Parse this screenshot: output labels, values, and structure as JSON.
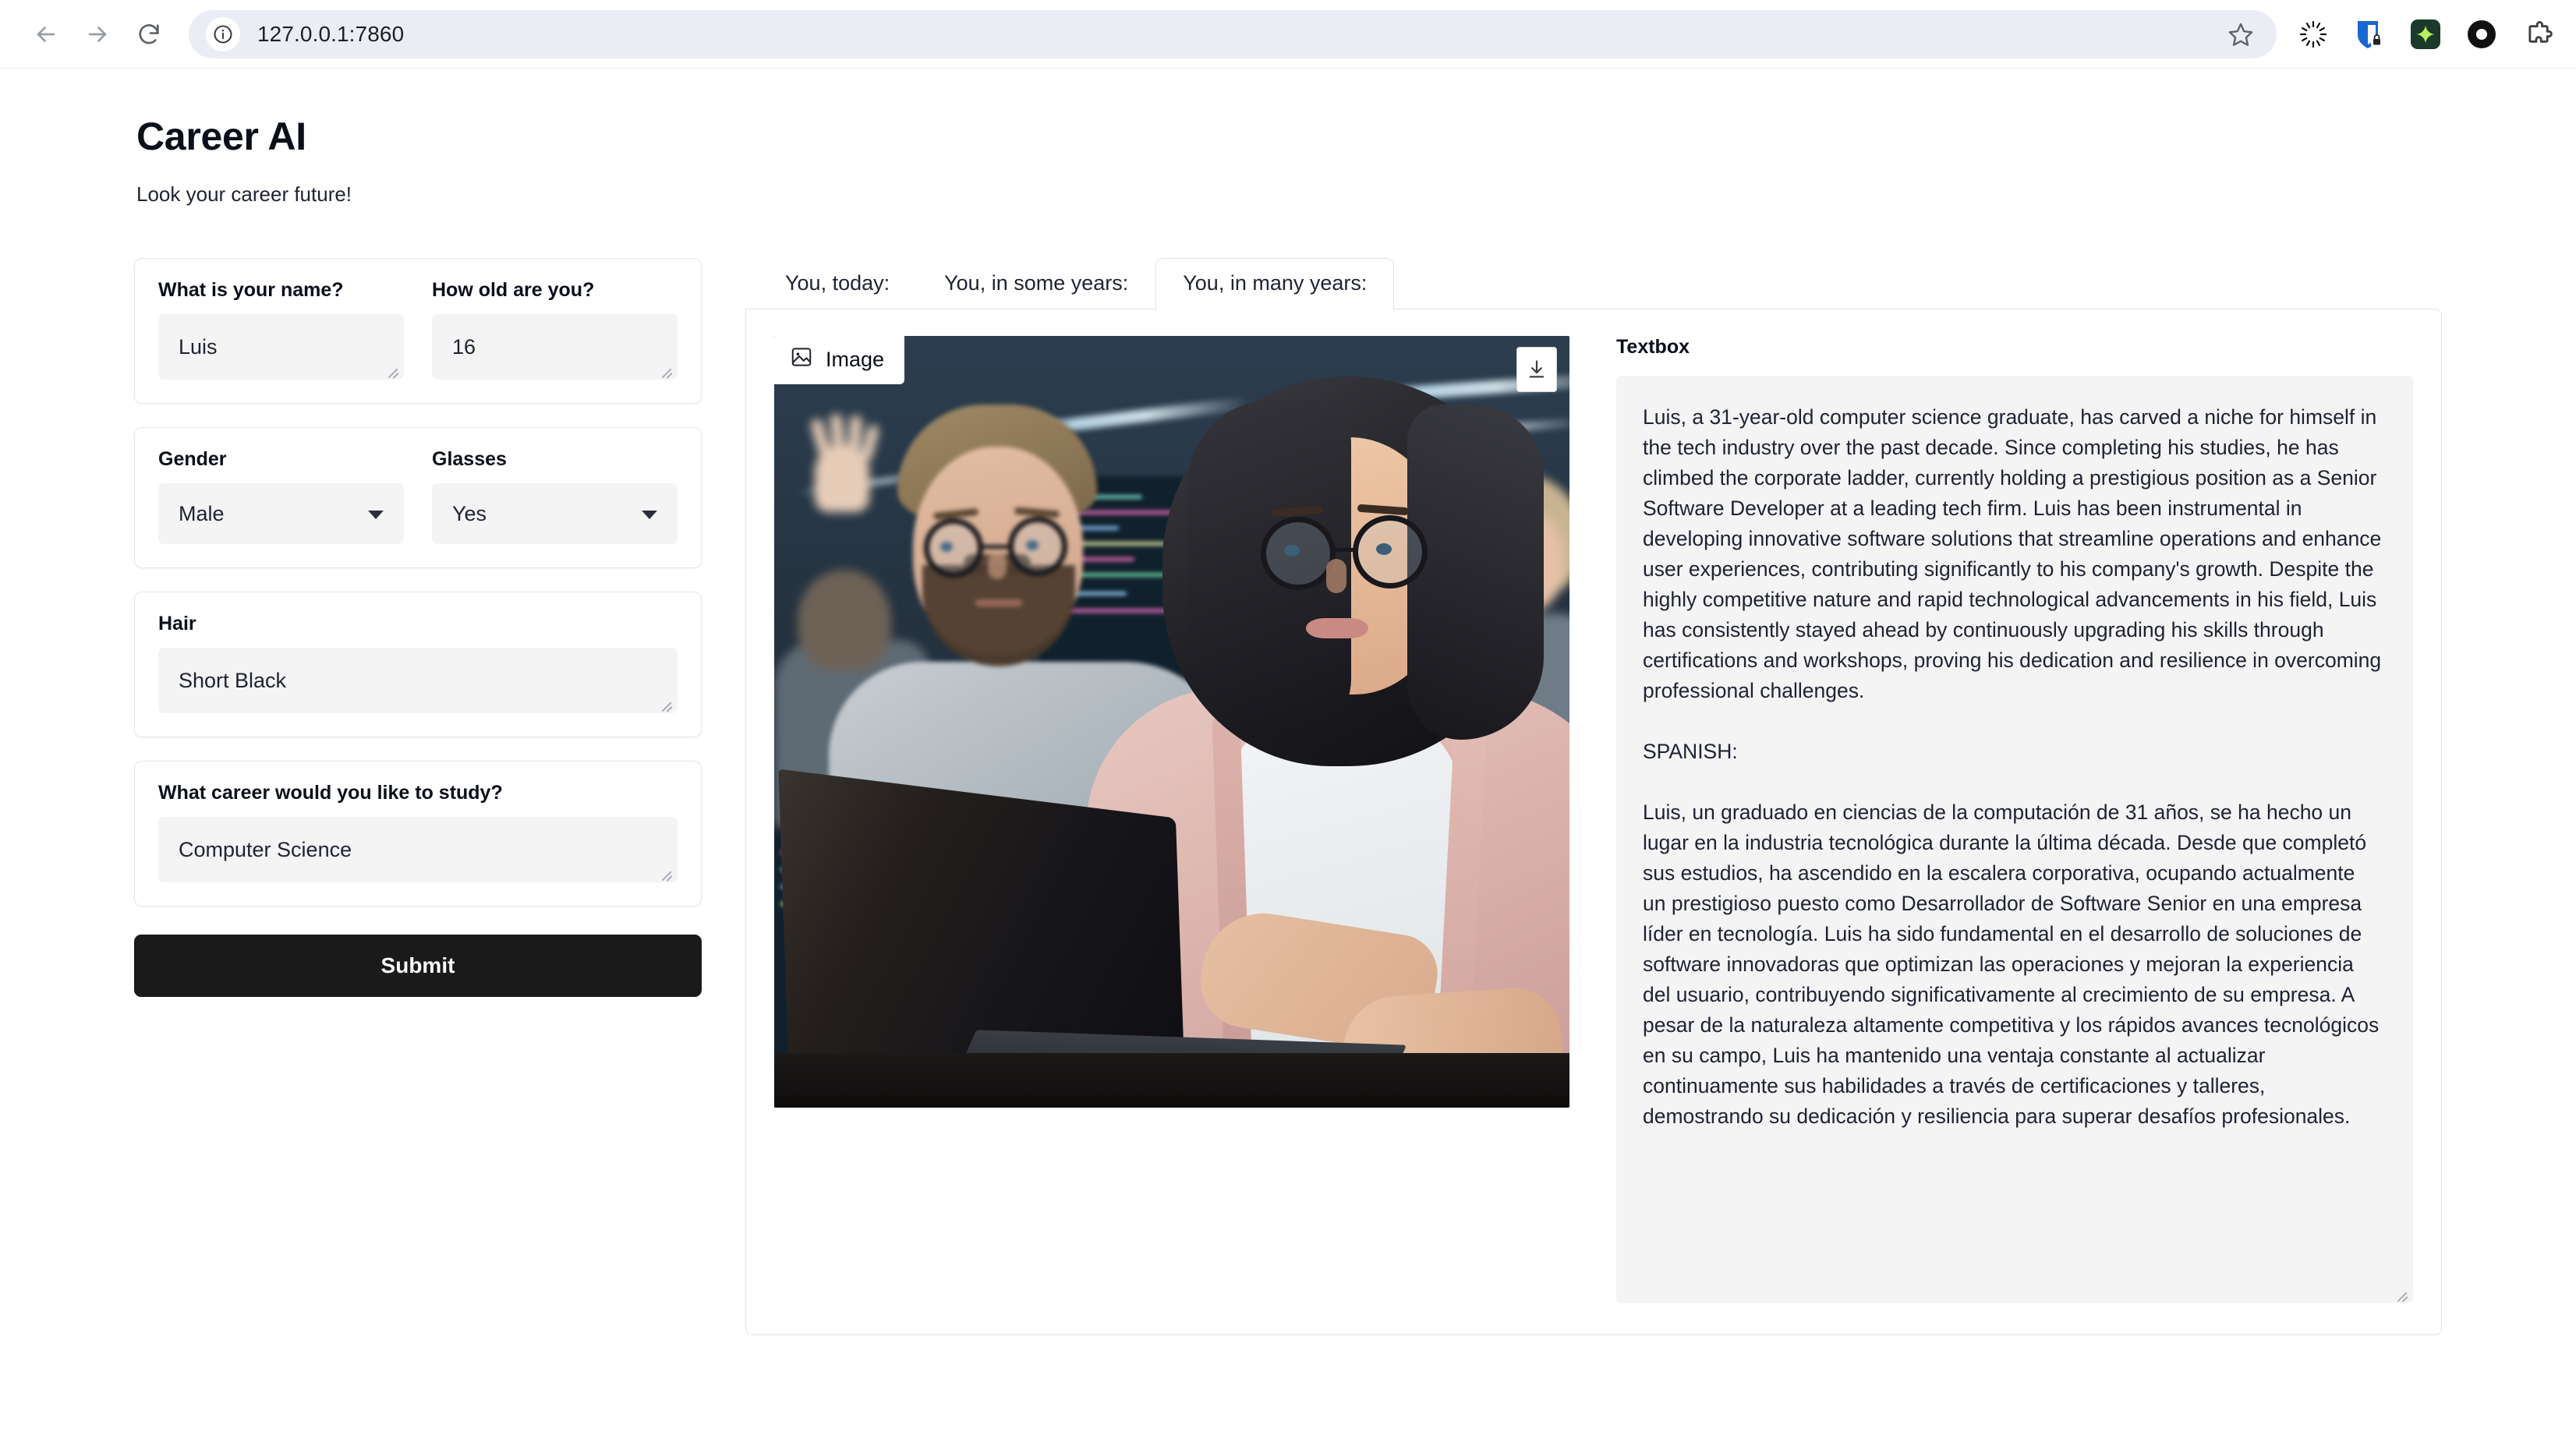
{
  "browser": {
    "url": "127.0.0.1:7860",
    "back_label": "Back",
    "forward_label": "Forward",
    "reload_label": "Reload",
    "site_info_label": "View site information",
    "bookmark_label": "Bookmark this tab",
    "extensions": [
      {
        "name": "loading-spinner-icon",
        "title": "Loading"
      },
      {
        "name": "shield-lock-icon",
        "title": "Privacy shield"
      },
      {
        "name": "gemini-sparkle-icon",
        "title": "Gemini"
      },
      {
        "name": "black-ring-icon",
        "title": "Recorder"
      },
      {
        "name": "puzzle-piece-icon",
        "title": "Extensions"
      }
    ]
  },
  "app": {
    "title": "Career AI",
    "subtitle": "Look your career future!"
  },
  "form": {
    "name": {
      "label": "What is your name?",
      "value": "Luis"
    },
    "age": {
      "label": "How old are you?",
      "value": "16"
    },
    "gender": {
      "label": "Gender",
      "value": "Male"
    },
    "glasses": {
      "label": "Glasses",
      "value": "Yes"
    },
    "hair": {
      "label": "Hair",
      "value": "Short Black"
    },
    "career": {
      "label": "What career would you like to study?",
      "value": "Computer Science"
    },
    "submit_label": "Submit"
  },
  "tabs": [
    {
      "label": "You, today:",
      "active": false
    },
    {
      "label": "You, in some years:",
      "active": false
    },
    {
      "label": "You, in many years:",
      "active": true
    }
  ],
  "output": {
    "image": {
      "label": "Image",
      "icon": "picture-icon",
      "download_icon": "download-icon",
      "alt": "Two software developers wearing glasses working together at a laptop in a modern open-plan tech office with code on monitors"
    },
    "textbox": {
      "label": "Textbox",
      "paragraphs": [
        "Luis, a 31-year-old computer science graduate, has carved a niche for himself in the tech industry over the past decade. Since completing his studies, he has climbed the corporate ladder, currently holding a prestigious position as a Senior Software Developer at a leading tech firm. Luis has been instrumental in developing innovative software solutions that streamline operations and enhance user experiences, contributing significantly to his company's growth. Despite the highly competitive nature and rapid technological advancements in his field, Luis has consistently stayed ahead by continuously upgrading his skills through certifications and workshops, proving his dedication and resilience in overcoming professional challenges.",
        "SPANISH:",
        "Luis, un graduado en ciencias de la computación de 31 años, se ha hecho un lugar en la industria tecnológica durante la última década. Desde que completó sus estudios, ha ascendido en la escalera corporativa, ocupando actualmente un prestigioso puesto como Desarrollador de Software Senior en una empresa líder en tecnología. Luis ha sido fundamental en el desarrollo de soluciones de software innovadoras que optimizan las operaciones y mejoran la experiencia del usuario, contribuyendo significativamente al crecimiento de su empresa. A pesar de la naturaleza altamente competitiva y los rápidos avances tecnológicos en su campo, Luis ha mantenido una ventaja constante al actualizar continuamente sus habilidades a través de certificaciones y talleres, demostrando su dedicación y resiliencia para superar desafíos profesionales."
      ]
    }
  },
  "colors": {
    "accent": "#1a1a1a",
    "field_bg": "#f4f4f5",
    "border": "#e1e2e6",
    "omnibox_bg": "#eaedf4"
  }
}
